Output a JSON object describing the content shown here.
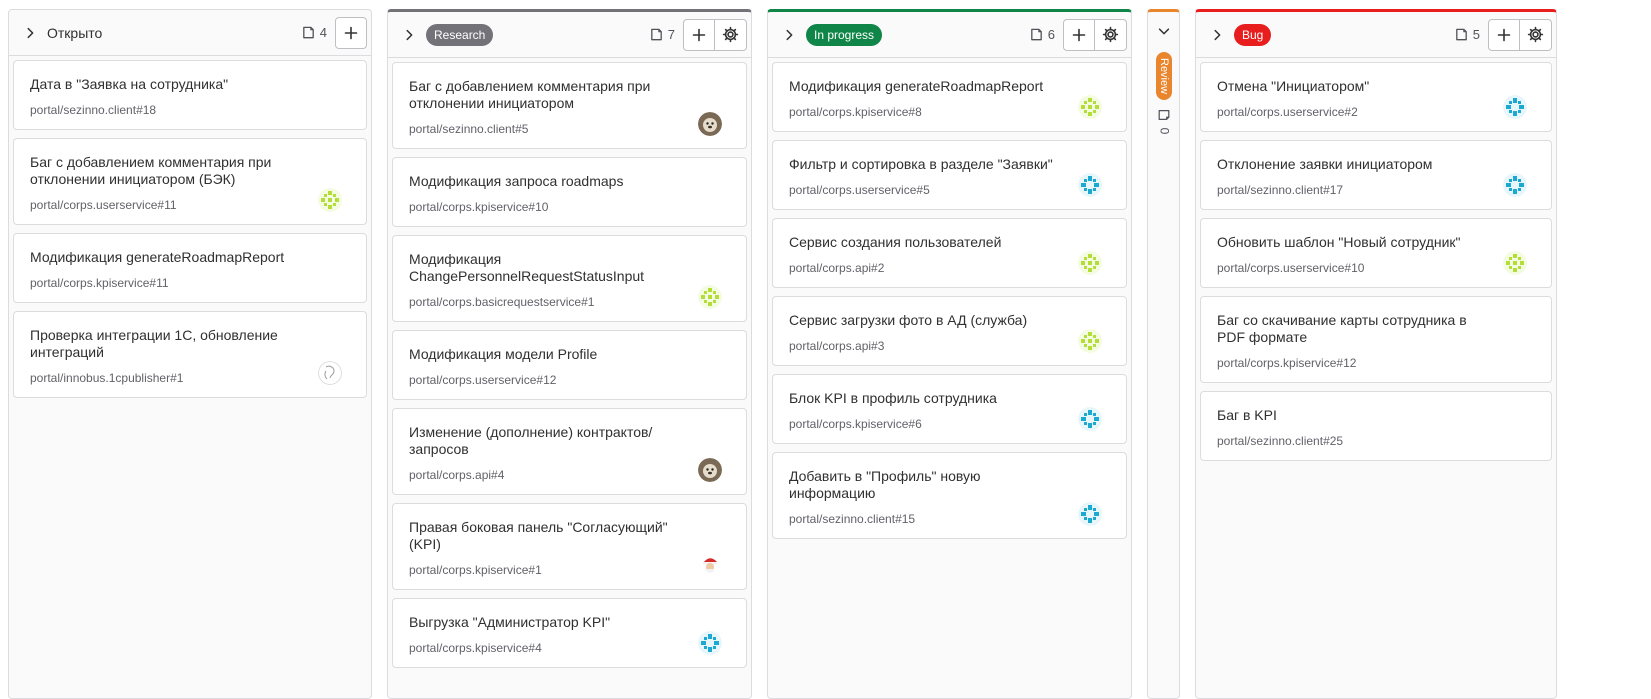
{
  "lists": [
    {
      "title": "Открыто",
      "count": "4",
      "cards": [
        {
          "title": "Дата в \"Заявка на сотрудника\"",
          "ref": "portal/sezinno.client",
          "num": "#18",
          "avatar": ""
        },
        {
          "title": "Баг с добавлением комментария при отклонении инициатором (БЭК)",
          "ref": "portal/corps.userservice",
          "num": "#11",
          "avatar": "green-pattern"
        },
        {
          "title": "Модификация generateRoadmapReport",
          "ref": "portal/corps.kpiservice",
          "num": "#11",
          "avatar": ""
        },
        {
          "title": "Проверка интеграции 1С, обновление интеграций",
          "ref": "portal/innobus.1cpublisher",
          "num": "#1",
          "avatar": "sketch"
        }
      ]
    },
    {
      "title": "Research",
      "color": "#737278",
      "count": "7",
      "cards": [
        {
          "title": "Баг с добавлением комментария при отклонении инициатором",
          "ref": "portal/sezinno.client",
          "num": "#5",
          "avatar": "dog"
        },
        {
          "title": "Модификация запроса roadmaps",
          "ref": "portal/corps.kpiservice",
          "num": "#10",
          "avatar": ""
        },
        {
          "title": "Модификация ChangePersonnelRequestStatusInput",
          "ref": "portal/corps.basicrequestservice",
          "num": "#1",
          "avatar": "green-pattern"
        },
        {
          "title": "Модификация модели Profile",
          "ref": "portal/corps.userservice",
          "num": "#12",
          "avatar": ""
        },
        {
          "title": "Изменение (дополнение) контрактов/запросов",
          "ref": "portal/corps.api",
          "num": "#4",
          "avatar": "dog"
        },
        {
          "title": "Правая боковая панель \"Согласующий\" (KPI)",
          "ref": "portal/corps.kpiservice",
          "num": "#1",
          "avatar": "santa"
        },
        {
          "title": "Выгрузка \"Администратор KPI\"",
          "ref": "portal/corps.kpiservice",
          "num": "#4",
          "avatar": "teal-pattern"
        }
      ]
    },
    {
      "title": "In progress",
      "color": "#108548",
      "count": "6",
      "cards": [
        {
          "title": "Модификация generateRoadmapReport",
          "ref": "portal/corps.kpiservice",
          "num": "#8",
          "avatar": "green-pattern"
        },
        {
          "title": "Фильтр и сортировка в разделе \"Заявки\"",
          "ref": "portal/corps.userservice",
          "num": "#5",
          "avatar": "teal-pattern"
        },
        {
          "title": "Сервис создания пользователей",
          "ref": "portal/corps.api",
          "num": "#2",
          "avatar": "green-pattern"
        },
        {
          "title": "Сервис загрузки фото в АД (служба)",
          "ref": "portal/corps.api",
          "num": "#3",
          "avatar": "green-pattern"
        },
        {
          "title": "Блок KPI в профиль сотрудника",
          "ref": "portal/corps.kpiservice",
          "num": "#6",
          "avatar": "teal-pattern"
        },
        {
          "title": "Добавить в \"Профиль\" новую информацию",
          "ref": "portal/sezinno.client",
          "num": "#15",
          "avatar": "teal-pattern"
        }
      ]
    },
    {
      "title": "Review",
      "color": "#e9852d",
      "count": "0"
    },
    {
      "title": "Bug",
      "color": "#e81d1d",
      "count": "5",
      "cards": [
        {
          "title": "Отмена \"Инициатором\"",
          "ref": "portal/corps.userservice",
          "num": "#2",
          "avatar": "teal-pattern"
        },
        {
          "title": "Отклонение заявки инициатором",
          "ref": "portal/sezinno.client",
          "num": "#17",
          "avatar": "teal-pattern"
        },
        {
          "title": "Обновить шаблон \"Новый сотрудник\"",
          "ref": "portal/corps.userservice",
          "num": "#10",
          "avatar": "green-pattern"
        },
        {
          "title": "Баг со скачивание карты сотрудника в PDF формате",
          "ref": "portal/corps.kpiservice",
          "num": "#12",
          "avatar": ""
        },
        {
          "title": "Баг в KPI",
          "ref": "portal/sezinno.client",
          "num": "#25",
          "avatar": ""
        }
      ]
    }
  ]
}
